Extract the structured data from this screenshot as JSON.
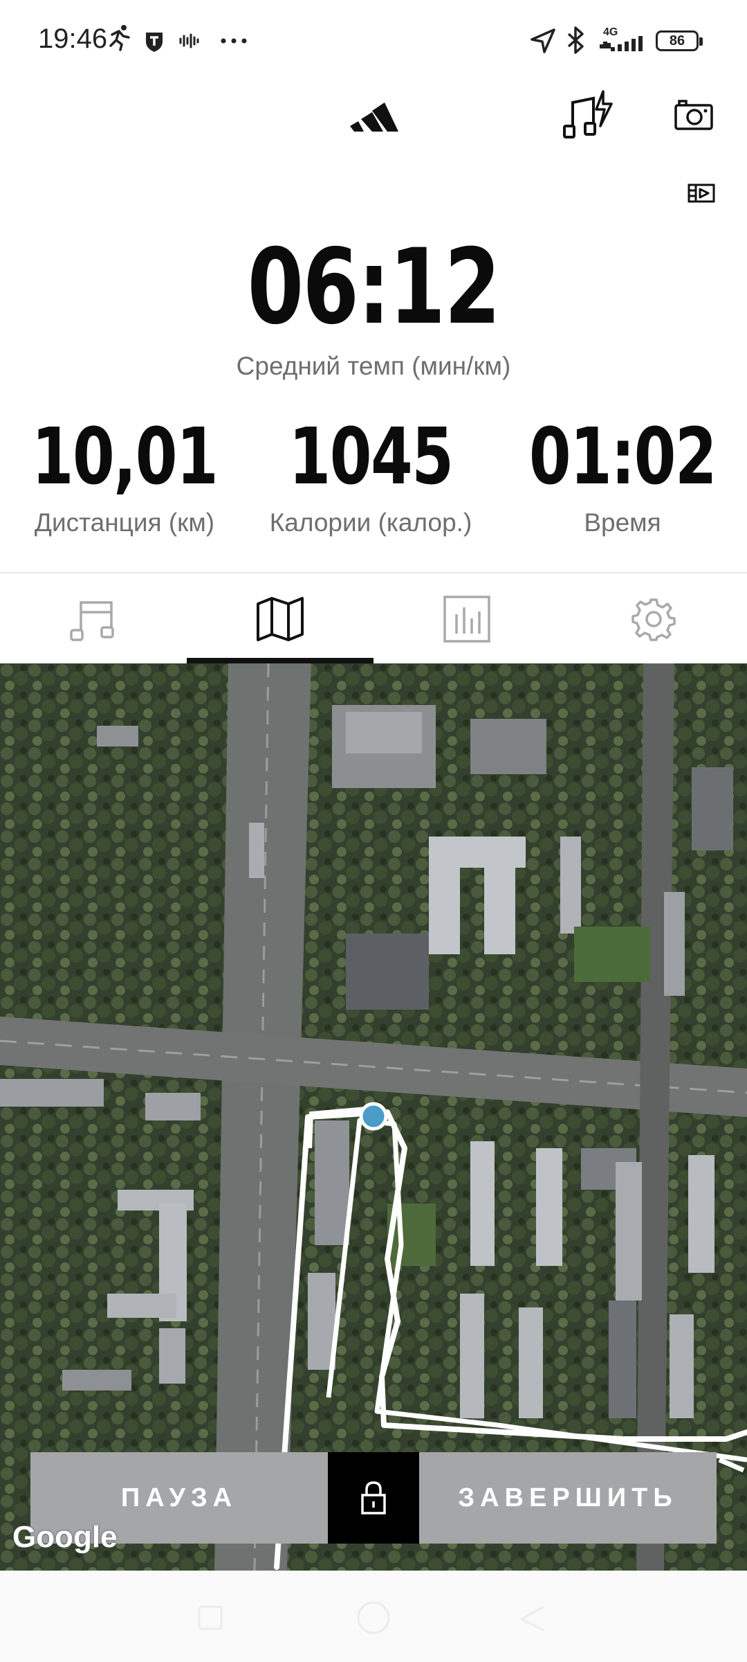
{
  "status_bar": {
    "time": "19:46",
    "network": "4G",
    "battery": "86",
    "icons_left": [
      "running-icon",
      "shield-icon",
      "voice-icon",
      "more-dots-icon"
    ],
    "icons_right": [
      "location-icon",
      "bluetooth-icon",
      "signal-icon",
      "battery-icon"
    ]
  },
  "header": {
    "brand_icon": "adidas-logo",
    "music_icon": "music-power-icon",
    "camera_icon": "camera-icon",
    "video_icon": "video-toggle-icon"
  },
  "primary_metric": {
    "value": "06:12",
    "label": "Средний темп (мин/км)"
  },
  "metrics": [
    {
      "value": "10,01",
      "label": "Дистанция (км)"
    },
    {
      "value": "1045",
      "label": "Калории (калор.)"
    },
    {
      "value": "01:02",
      "label": "Время"
    }
  ],
  "tabs": [
    {
      "icon": "music-icon",
      "active": false
    },
    {
      "icon": "map-icon",
      "active": true
    },
    {
      "icon": "chart-icon",
      "active": false
    },
    {
      "icon": "gear-icon",
      "active": false
    }
  ],
  "map": {
    "attribution": "Google"
  },
  "controls": {
    "pause_label": "ПАУЗА",
    "finish_label": "ЗАВЕРШИТЬ",
    "lock_icon": "lock-icon"
  },
  "colors": {
    "accent_dot": "#4a9cc9",
    "button_gray": "#a4a6a8",
    "lock_bg": "#000000"
  }
}
